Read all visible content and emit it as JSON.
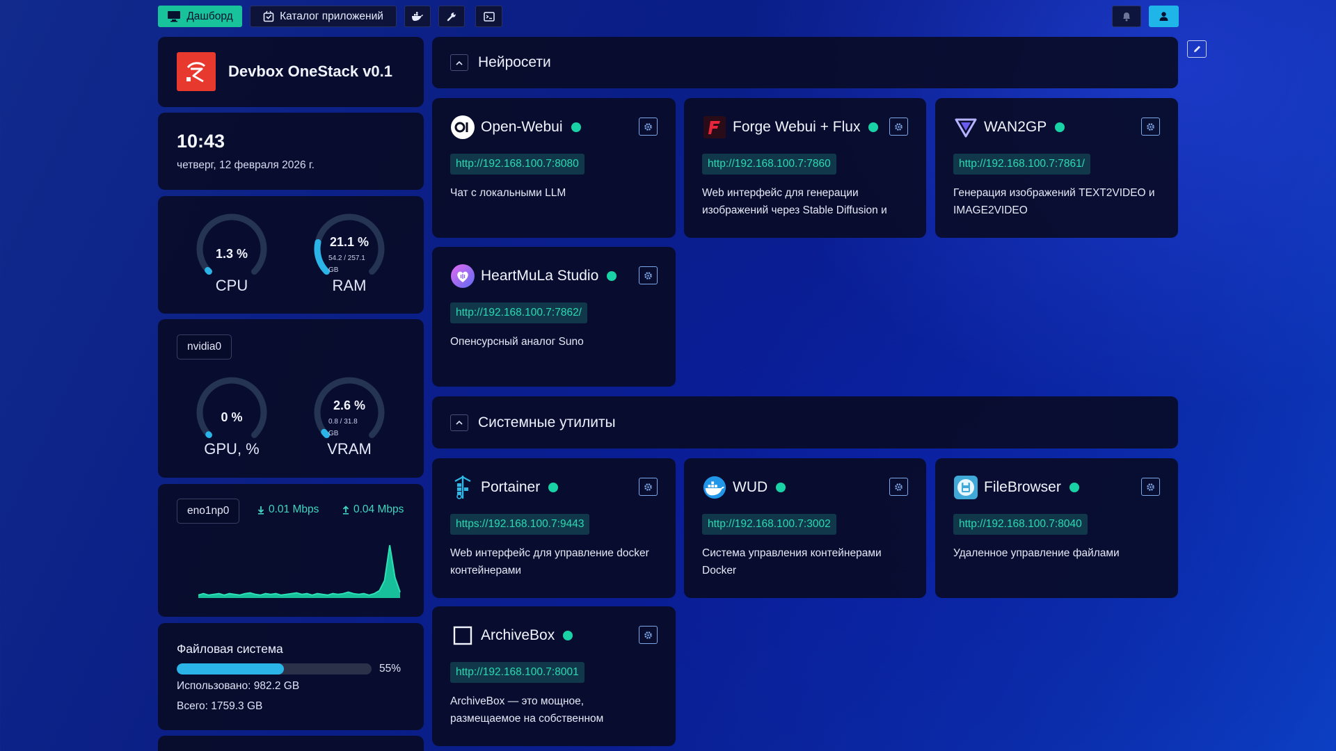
{
  "topbar": {
    "dashboard_label": "Дашборд",
    "catalog_label": "Каталог приложений"
  },
  "brand": {
    "title": "Devbox OneStack v0.1"
  },
  "clock": {
    "time": "10:43",
    "date": "четверг, 12 февраля 2026 г."
  },
  "system": {
    "cpu": {
      "value": "1.3 %",
      "label": "CPU",
      "fraction": 0.013
    },
    "ram": {
      "value": "21.1 %",
      "detail": "54.2 / 257.1",
      "unit": "GB",
      "label": "RAM",
      "fraction": 0.211
    }
  },
  "gpu": {
    "device": "nvidia0",
    "gpu": {
      "value": "0 %",
      "label": "GPU, %",
      "fraction": 0
    },
    "vram": {
      "value": "2.6 %",
      "detail": "0.8 / 31.8",
      "unit": "GB",
      "label": "VRAM",
      "fraction": 0.026
    }
  },
  "network": {
    "interface": "eno1np0",
    "download": "0.01 Mbps",
    "upload": "0.04 Mbps",
    "series": [
      0.2,
      0.3,
      0.2,
      0.25,
      0.3,
      0.2,
      0.3,
      0.25,
      0.2,
      0.3,
      0.35,
      0.25,
      0.2,
      0.3,
      0.25,
      0.3,
      0.2,
      0.25,
      0.3,
      0.35,
      0.25,
      0.3,
      0.2,
      0.3,
      0.25,
      0.2,
      0.3,
      0.25,
      0.3,
      0.4,
      0.3,
      0.25,
      0.3,
      0.2,
      0.3,
      0.5,
      1.2,
      3.6,
      1.4,
      0.4
    ]
  },
  "filesystem": {
    "title": "Файловая система",
    "percent_label": "55%",
    "fraction": 0.55,
    "used": "Использовано: 982.2 GB",
    "total": "Всего: 1759.3 GB"
  },
  "sections": [
    {
      "title": "Нейросети",
      "apps": [
        {
          "name": "Open-Webui",
          "icon": "openwebui-icon",
          "url": "http://192.168.100.7:8080",
          "desc": "Чат с локальными LLM"
        },
        {
          "name": "Forge Webui + Flux",
          "icon": "forge-icon",
          "url": "http://192.168.100.7:7860",
          "desc": "Web интерфейс для генерации изображений через Stable Diffusion и"
        },
        {
          "name": "WAN2GP",
          "icon": "wan2gp-icon",
          "url": "http://192.168.100.7:7861/",
          "desc": "Генерация изображений TEXT2VIDEO и IMAGE2VIDEO"
        },
        {
          "name": "HeartMuLa Studio",
          "icon": "heartmula-icon",
          "url": "http://192.168.100.7:7862/",
          "desc": "Опенсурсный аналог Suno"
        }
      ]
    },
    {
      "title": "Системные утилиты",
      "apps": [
        {
          "name": "Portainer",
          "icon": "portainer-icon",
          "url": "https://192.168.100.7:9443",
          "desc": "Web интерфейс для управление docker контейнерами"
        },
        {
          "name": "WUD",
          "icon": "wud-whale-icon",
          "url": "http://192.168.100.7:3002",
          "desc": "Система управления контейнерами Docker"
        },
        {
          "name": "FileBrowser",
          "icon": "filebrowser-icon",
          "url": "http://192.168.100.7:8040",
          "desc": "Удаленное управление файлами"
        },
        {
          "name": "ArchiveBox",
          "icon": "archivebox-icon",
          "url": "http://192.168.100.7:8001",
          "desc": "ArchiveBox — это мощное, размещаемое на собственном"
        }
      ]
    }
  ],
  "colors": {
    "accent": "#18c39c",
    "status_ok": "#19d3a7",
    "gauge": "#2ab4e8",
    "user_button": "#1fb5e8"
  }
}
